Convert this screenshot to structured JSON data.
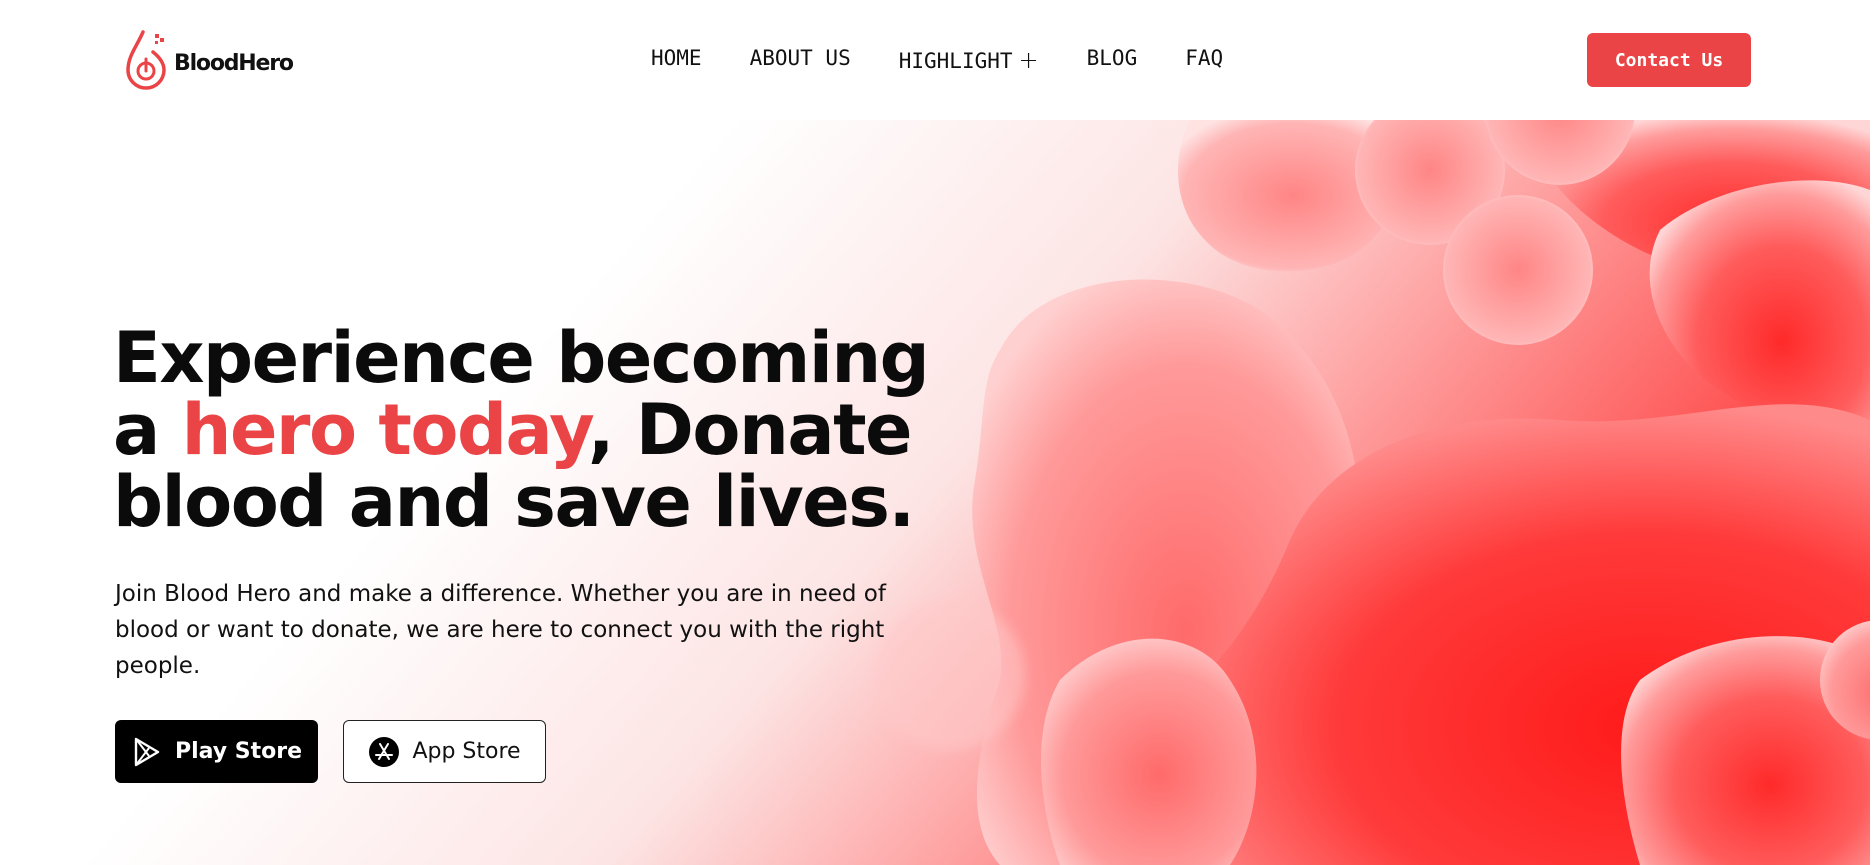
{
  "brand": {
    "name": "BloodHero",
    "accent_color": "#ea4446"
  },
  "nav": {
    "items": [
      {
        "label": "HOME"
      },
      {
        "label": "ABOUT US"
      },
      {
        "label": "HIGHLIGHT",
        "icon": "plus-icon"
      },
      {
        "label": "BLOG"
      },
      {
        "label": "FAQ"
      }
    ],
    "contact_label": "Contact Us"
  },
  "hero": {
    "title_line1": "Experience becoming",
    "title_line2_prefix": "a ",
    "title_highlight": "hero today",
    "title_line2_suffix": ", Donate",
    "title_line3": "blood and save lives.",
    "description": "Join Blood Hero and make a difference. Whether you are in need of blood or want to donate, we are here to connect you with the right people.",
    "play_store_label": "Play Store",
    "app_store_label": "App Store",
    "play_icon": "play-store-icon",
    "app_icon": "app-store-icon"
  }
}
